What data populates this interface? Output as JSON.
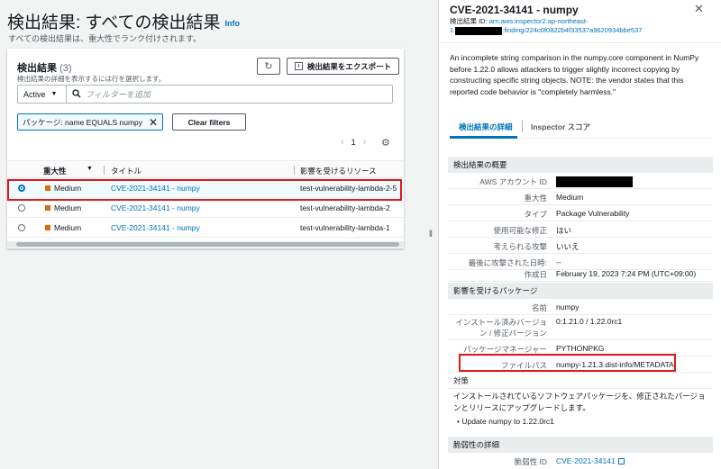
{
  "page": {
    "title": "検出結果: すべての検出結果",
    "info": "Info",
    "description": "すべての検出結果は、重大性でランク付けされます。"
  },
  "findings_panel": {
    "title": "検出結果",
    "count": "(3)",
    "subtitle": "検出結果の詳細を表示するには行を選択します。",
    "export_label": "検出結果をエクスポート",
    "status_value": "Active",
    "filter_placeholder": "フィルターを追加",
    "token_text": "パッケージ: name EQUALS numpy",
    "clear_filters": "Clear filters",
    "page_number": "1",
    "columns": {
      "severity": "重大性",
      "title": "タイトル",
      "resource": "影響を受けるリソース"
    },
    "rows": [
      {
        "severity": "Medium",
        "title": "CVE-2021-34141 - numpy",
        "resource": "test-vulnerability-lambda-2-5"
      },
      {
        "severity": "Medium",
        "title": "CVE-2021-34141 - numpy",
        "resource": "test-vulnerability-lambda-2"
      },
      {
        "severity": "Medium",
        "title": "CVE-2021-34141 - numpy",
        "resource": "test-vulnerability-lambda-1"
      }
    ]
  },
  "detail": {
    "title": "CVE-2021-34141 - numpy",
    "id_label": "検出結果 ID:",
    "id_part1": "arn:aws:inspector2:ap-northeast-",
    "id_part2_prefix": "1:",
    "id_part2_suffix": ":finding/224c0f0822b4f33537a9620934bbe537",
    "description": "An incomplete string comparison in the numpy.core component in NumPy before 1.22.0 allows attackers to trigger slightly incorrect copying by constructing specific string objects. NOTE: the vendor states that this reported code behavior is \"completely harmless.\"",
    "tabs": {
      "details": "検出結果の詳細",
      "score": "Inspector スコア"
    },
    "overview": {
      "heading": "検出結果の概要",
      "account_label": "AWS アカウント ID",
      "severity_label": "重大性",
      "severity_value": "Medium",
      "type_label": "タイプ",
      "type_value": "Package Vulnerability",
      "fix_label": "使用可能な修正",
      "fix_value": "はい",
      "exploit_label": "考えられる攻撃",
      "exploit_value": "いいえ",
      "last_exploited_label": "最後に攻撃された日時:",
      "last_exploited_value": "--",
      "created_label": "作成日",
      "created_value": "February 19, 2023 7:24 PM (UTC+09:00)"
    },
    "package": {
      "heading": "影響を受けるパッケージ",
      "name_label": "名前",
      "name_value": "numpy",
      "version_label": "インストール済みバージョン / 修正バージョン",
      "version_value": "0:1.21.0 / 1.22.0rc1",
      "manager_label": "パッケージマネージャー",
      "manager_value": "PYTHONPKG",
      "path_label": "ファイルパス",
      "path_value": "numpy-1.21.3.dist-info/METADATA"
    },
    "remediation": {
      "heading": "対策",
      "text": "インストールされているソフトウェアパッケージを、修正されたバージョンとリリースにアップグレードします。",
      "bullet": "Update numpy to 1.22.0rc1"
    },
    "vuln": {
      "heading": "脆弱性の詳細",
      "id_label": "脆弱性 ID",
      "id_value": "CVE-2021-34141"
    }
  },
  "colors": {
    "link": "#0073bb",
    "medium": "#dd6b10",
    "highlight": "#e0191c"
  }
}
